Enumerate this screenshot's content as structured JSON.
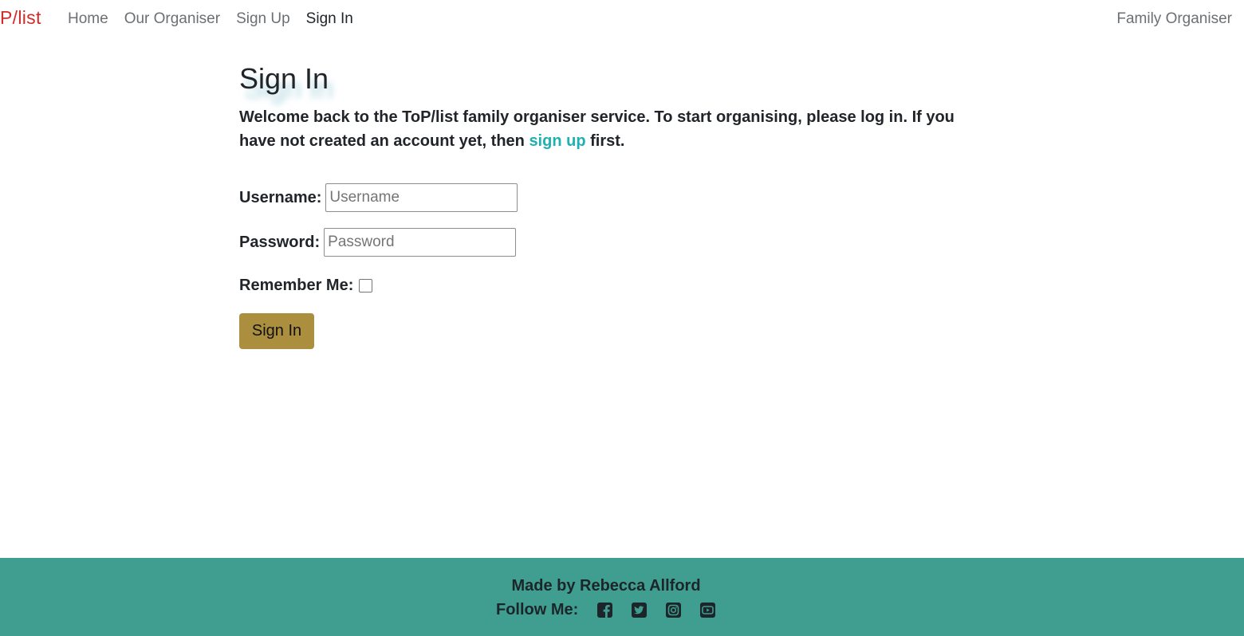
{
  "nav": {
    "brand": "P/list",
    "links": [
      {
        "label": "Home"
      },
      {
        "label": "Our Organiser"
      },
      {
        "label": "Sign Up"
      },
      {
        "label": "Sign In"
      }
    ],
    "right_label": "Family Organiser"
  },
  "main": {
    "title": "Sign In",
    "intro_text": "Welcome back to the ToP/list family organiser service. To start organising, please log in. If you have not created an account yet, then",
    "intro_link": "sign up",
    "intro_end": "first.",
    "form": {
      "username_label": "Username:",
      "username_placeholder": "Username",
      "password_label": "Password:",
      "password_placeholder": "Password",
      "remember_label": "Remember Me:",
      "submit_label": "Sign In"
    }
  },
  "footer": {
    "credit": "Made by Rebecca Allford",
    "follow_label": "Follow Me:",
    "social_icons": [
      "facebook-icon",
      "twitter-icon",
      "instagram-icon",
      "youtube-icon"
    ]
  },
  "colors": {
    "brand": "#d42a2a",
    "link": "#1fb0b0",
    "button": "#ab8f3e",
    "footer_bg": "#409e90"
  }
}
